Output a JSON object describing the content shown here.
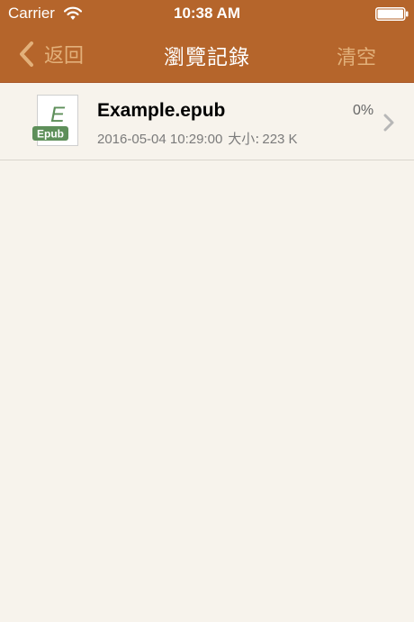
{
  "status_bar": {
    "carrier": "Carrier",
    "time": "10:38 AM",
    "wifi_icon": "wifi-icon",
    "battery_icon": "battery-icon"
  },
  "nav": {
    "back_label": "返回",
    "back_icon": "chevron-left-icon",
    "title": "瀏覽記錄",
    "clear_label": "清空"
  },
  "history": {
    "items": [
      {
        "icon_letter": "E",
        "icon_badge": "Epub",
        "name": "Example.epub",
        "date": "2016-05-04 10:29:00",
        "size_label": "大小:",
        "size_value": "223 K",
        "progress": "0%",
        "chevron_icon": "chevron-right-icon"
      }
    ]
  },
  "colors": {
    "nav_background": "#b5652b",
    "nav_button_text": "#e2b07a",
    "page_background": "#f7f3ec",
    "epub_badge": "#5e8f5a"
  }
}
